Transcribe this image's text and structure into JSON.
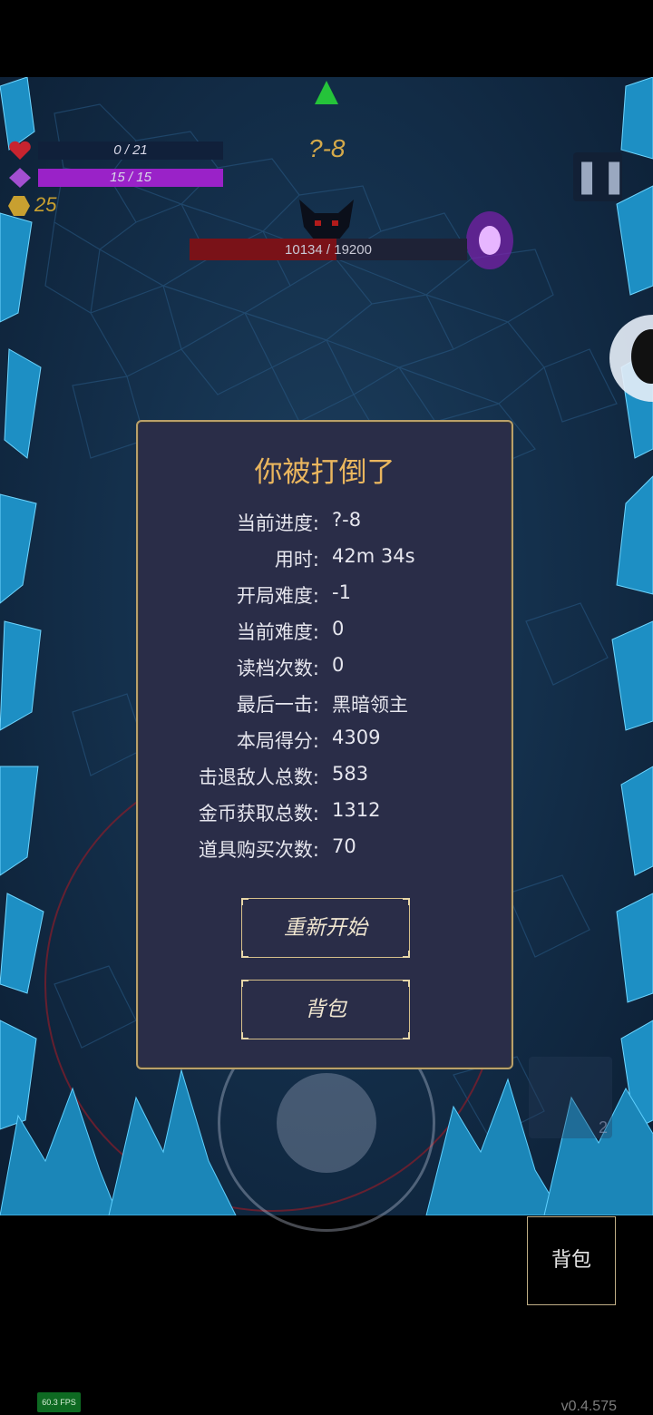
{
  "hud": {
    "hp_text": "0 / 21",
    "hp_fraction": 0,
    "mana_text": "15 / 15",
    "mana_fraction": 1.0,
    "gold": "25",
    "stage": "?-8",
    "boss_hp_text": "10134 / 19200",
    "boss_hp_fraction": 0.528,
    "pause_icon": "pause-icon",
    "colors": {
      "hp": "#c8242f",
      "mana": "#9a22c8",
      "gold": "#c8a030",
      "boss": "#7a1218"
    }
  },
  "dialog": {
    "title": "你被打倒了",
    "stats": [
      {
        "label": "当前进度:",
        "value": "?-8"
      },
      {
        "label": "用时:",
        "value": "42m 34s"
      },
      {
        "label": "开局难度:",
        "value": "-1"
      },
      {
        "label": "当前难度:",
        "value": "0"
      },
      {
        "label": "读档次数:",
        "value": "0"
      },
      {
        "label": "最后一击:",
        "value": "黑暗领主"
      },
      {
        "label": "本局得分:",
        "value": "4309"
      },
      {
        "label": "击退敌人总数:",
        "value": "583"
      },
      {
        "label": "金币获取总数:",
        "value": "1312"
      },
      {
        "label": "道具购买次数:",
        "value": "70"
      }
    ],
    "restart_label": "重新开始",
    "bag_label": "背包"
  },
  "corner_bag_label": "背包",
  "skill_count": "2",
  "fps": "60.3 FPS",
  "version": "v0.4.575"
}
